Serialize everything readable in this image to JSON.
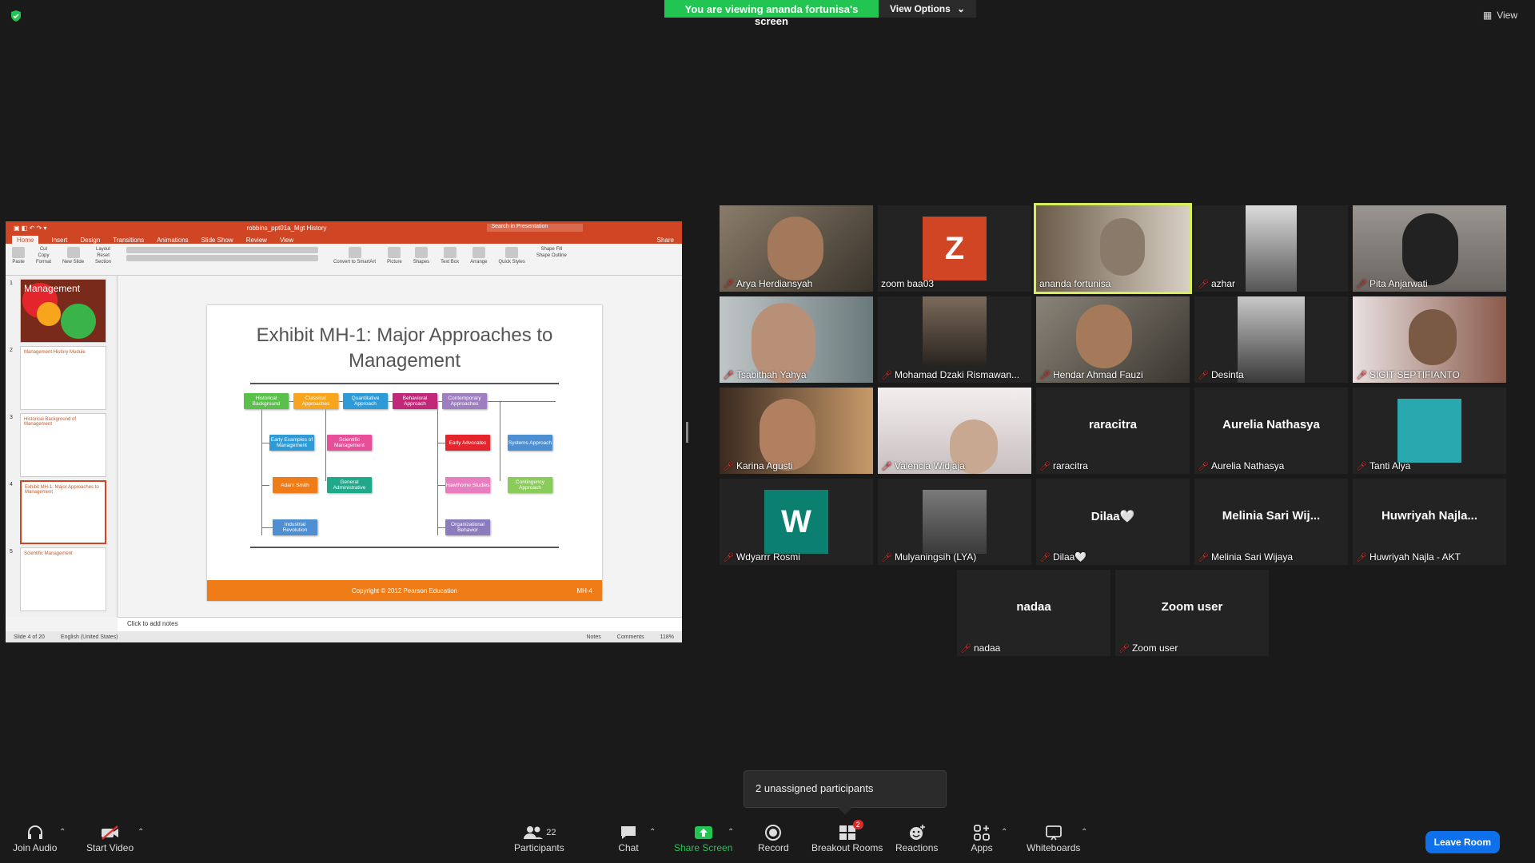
{
  "banner": {
    "viewing_text": "You are viewing ananda fortunisa's screen",
    "view_options_label": "View Options"
  },
  "view_label": "View",
  "ppt": {
    "file_title": "robbins_ppt01a_Mgt History",
    "search_placeholder": "Search in Presentation",
    "share_label": "Share",
    "tabs": [
      "Home",
      "Insert",
      "Design",
      "Transitions",
      "Animations",
      "Slide Show",
      "Review",
      "View"
    ],
    "ribbon": [
      "Paste",
      "Cut",
      "Copy",
      "Format",
      "New Slide",
      "Layout",
      "Reset",
      "Section",
      "Convert to SmartArt",
      "Picture",
      "Shapes",
      "Text Box",
      "Arrange",
      "Quick Styles",
      "Shape Fill",
      "Shape Outline"
    ],
    "thumbs": [
      {
        "num": "1",
        "title": "Management"
      },
      {
        "num": "2",
        "title": "Management History Module"
      },
      {
        "num": "3",
        "title": "Historical Background of Management"
      },
      {
        "num": "4",
        "title": "Exhibit MH-1: Major Approaches to Management"
      },
      {
        "num": "5",
        "title": "Scientific Management"
      }
    ],
    "slide": {
      "title": "Exhibit MH-1: Major Approaches to Management",
      "boxes": {
        "historical": "Historical Background",
        "classical": "Classical Approaches",
        "quantitative": "Quantitative Approach",
        "behavioral": "Behavioral Approach",
        "contemporary": "Contemporary Approaches",
        "early_examples": "Early Examples of Management",
        "scientific": "Scientific Management",
        "adam_smith": "Adam Smith",
        "general_admin": "General Administrative",
        "industrial": "Industrial Revolution",
        "early_advocates": "Early Advocates",
        "hawthorne": "Hawthorne Studies",
        "org_behavior": "Organizational Behavior",
        "systems": "Systems Approach",
        "contingency": "Contingency Approach"
      },
      "footer": "Copyright © 2012 Pearson Education",
      "page": "MH-4"
    },
    "notes_placeholder": "Click to add notes",
    "status": {
      "slide_of": "Slide 4 of 20",
      "language": "English (United States)",
      "notes": "Notes",
      "comments": "Comments",
      "zoom": "118%"
    }
  },
  "participants_tiles": [
    {
      "name": "Arya Herdiansyah"
    },
    {
      "name": "zoom baa03",
      "initial": "Z"
    },
    {
      "name": "ananda fortunisa"
    },
    {
      "name": "azhar"
    },
    {
      "name": "Pita Anjarwati"
    },
    {
      "name": "Tsabithah Yahya"
    },
    {
      "name": "Mohamad Dzaki Rismawan..."
    },
    {
      "name": "Hendar Ahmad Fauzi"
    },
    {
      "name": "Desinta"
    },
    {
      "name": "SIGIT SEPTIFIANTO"
    },
    {
      "name": "Karina Agusti"
    },
    {
      "name": "Valencia Widjaja"
    },
    {
      "name": "raracitra",
      "big": "raracitra"
    },
    {
      "name": "Aurelia Nathasya",
      "big": "Aurelia Nathasya"
    },
    {
      "name": "Tanti Alya"
    },
    {
      "name": "Wdyarrr Rosmi",
      "initial": "W"
    },
    {
      "name": "Mulyaningsih (LYA)"
    },
    {
      "name": "Dilaa🤍",
      "big": "Dilaa🤍"
    },
    {
      "name": "Melinia Sari Wijaya",
      "big": "Melinia Sari Wij..."
    },
    {
      "name": "Huwriyah Najla - AKT",
      "big": "Huwriyah Najla..."
    },
    {
      "name": "nadaa",
      "big": "nadaa"
    },
    {
      "name": "Zoom user",
      "big": "Zoom user"
    }
  ],
  "tooltip": "2 unassigned participants",
  "toolbar": {
    "join_audio": "Join Audio",
    "start_video": "Start Video",
    "participants": "Participants",
    "participants_count": "22",
    "chat": "Chat",
    "share_screen": "Share Screen",
    "record": "Record",
    "breakout_rooms": "Breakout Rooms",
    "breakout_badge": "2",
    "reactions": "Reactions",
    "apps": "Apps",
    "whiteboards": "Whiteboards",
    "leave": "Leave Room"
  },
  "colors": {
    "zoom_green": "#23c552",
    "zoom_blue": "#0e71eb",
    "ppt_orange": "#d04524",
    "active_speaker": "#d6ee5b"
  }
}
